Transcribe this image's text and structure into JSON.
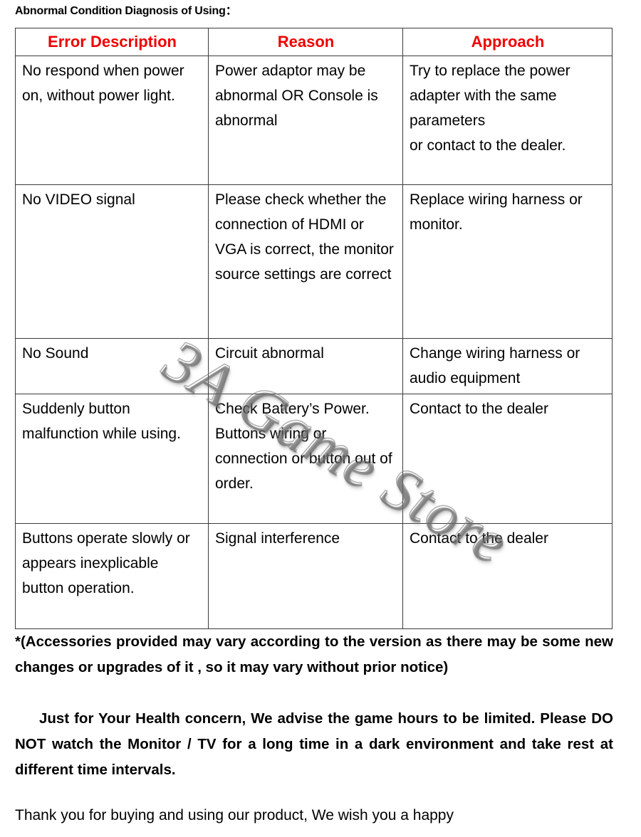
{
  "document": {
    "title": "Abnormal Condition Diagnosis of Using：",
    "watermark": "3A Game Store",
    "header_color": "#ef0000"
  },
  "table": {
    "headers": {
      "error": "Error Description",
      "reason": "Reason",
      "approach": "Approach"
    },
    "rows": [
      {
        "error": "No respond when power on, without power light.",
        "reason": "Power adaptor may be abnormal OR Console is abnormal",
        "approach_line1": "Try to replace the power adapter with the same parameters",
        "approach_line2": "or contact to the dealer."
      },
      {
        "error": "No VIDEO signal",
        "reason": "Please check whether the connection of HDMI or VGA is correct, the monitor source settings are correct",
        "approach": "Replace wiring harness or monitor."
      },
      {
        "error": "No Sound",
        "reason": "Circuit abnormal",
        "approach": "Change wiring harness or audio equipment"
      },
      {
        "error": "Suddenly button malfunction while using.",
        "reason_line1": "Check Battery’s Power.",
        "reason_line2": "Buttons wiring or connection or button out of order.",
        "approach": "Contact to the dealer"
      },
      {
        "error": "Buttons operate slowly or appears inexplicable button operation.",
        "reason": "Signal interference",
        "approach": "Contact to the dealer"
      }
    ]
  },
  "notices": {
    "accessories": "*(Accessories provided may vary according to the    version as    there may be some new changes or upgrades of it , so it   may   vary without prior notice)",
    "health": "Just for Your Health concern, We advise the game hours to be limited. Please DO NOT watch the Monitor / TV for a long time in a dark environment and take rest at different time intervals."
  },
  "closing": {
    "thanks": "Thank you for buying and using our product, We wish you a happy"
  }
}
